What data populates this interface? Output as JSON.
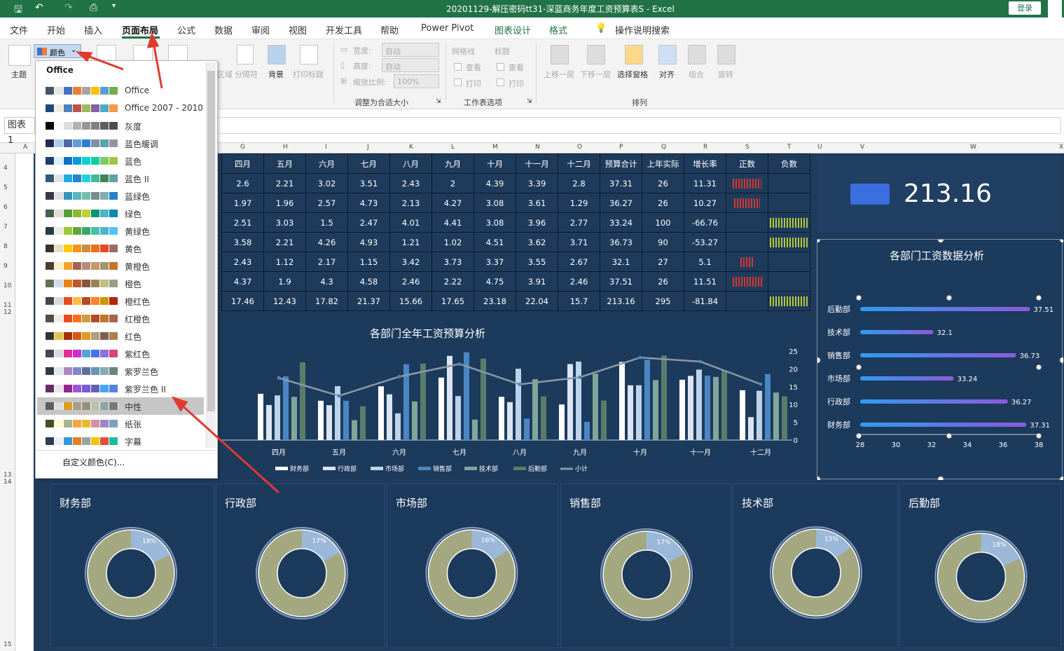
{
  "titlebar": {
    "title": "20201129-解压密码tt31-深蓝商务年度工资预算表S - Excel",
    "login": "登录"
  },
  "menu": {
    "tabs": [
      "文件",
      "开始",
      "插入",
      "页面布局",
      "公式",
      "数据",
      "审阅",
      "视图",
      "开发工具",
      "帮助",
      "Power Pivot",
      "图表设计",
      "格式"
    ],
    "search": "操作说明搜索"
  },
  "ribbon": {
    "themes": "主题",
    "colors": "颜色",
    "background": "背景",
    "print_titles": "打印标题",
    "breaks": "分隔符",
    "area": "区域",
    "width_label": "宽度:",
    "width_value": "自动",
    "height_label": "高度:",
    "height_value": "自动",
    "scale_label": "缩放比例:",
    "scale_value": "100%",
    "fit_group": "调整为合适大小",
    "gridlines": "网格线",
    "headings": "标题",
    "view1": "查看",
    "print1": "打印",
    "view2": "查看",
    "print2": "打印",
    "sheet_options": "工作表选项",
    "bring_forward": "上移一层",
    "send_backward": "下移一层",
    "selection_pane": "选择窗格",
    "align": "对齐",
    "group": "组合",
    "rotate": "旋转",
    "arrange": "排列"
  },
  "formula": {
    "namebox": "图表 1"
  },
  "columns": [
    "A",
    "G",
    "H",
    "I",
    "J",
    "K",
    "L",
    "M",
    "N",
    "O",
    "P",
    "Q",
    "R",
    "S",
    "T",
    "U",
    "V",
    "W",
    "X"
  ],
  "rows": [
    "4",
    "5",
    "6",
    "7",
    "8",
    "9",
    "10",
    "11",
    "12",
    "13",
    "14",
    "15"
  ],
  "dropdown": {
    "header": "Office",
    "items": [
      {
        "name": "Office",
        "colors": [
          "#44546a",
          "#e7e6e6",
          "#4472c4",
          "#ed7d31",
          "#a5a5a5",
          "#ffc000",
          "#5b9bd5",
          "#70ad47"
        ]
      },
      {
        "name": "Office 2007 - 2010",
        "colors": [
          "#1f497d",
          "#eeece1",
          "#4f81bd",
          "#c0504d",
          "#9bbb59",
          "#8064a2",
          "#4bacc6",
          "#f79646"
        ]
      },
      {
        "name": "灰度",
        "colors": [
          "#000000",
          "#f8f8f8",
          "#dddddd",
          "#b2b2b2",
          "#969696",
          "#808080",
          "#5f5f5f",
          "#4d4d4d"
        ]
      },
      {
        "name": "蓝色暖调",
        "colors": [
          "#242852",
          "#acccea",
          "#4a66ac",
          "#629dd1",
          "#297fd5",
          "#7f8fa9",
          "#5aa2ae",
          "#9d90a0"
        ]
      },
      {
        "name": "蓝色",
        "colors": [
          "#17406d",
          "#dbeff9",
          "#0f6fc6",
          "#009dd9",
          "#0bd0d9",
          "#10cf9b",
          "#7cca62",
          "#a5c249"
        ]
      },
      {
        "name": "蓝色 II",
        "colors": [
          "#335b74",
          "#dfe3e5",
          "#1cade4",
          "#2683c6",
          "#27ced7",
          "#42ba97",
          "#3e8853",
          "#62a39f"
        ]
      },
      {
        "name": "蓝绿色",
        "colors": [
          "#373545",
          "#dedede",
          "#3494ba",
          "#58b6c0",
          "#75bda7",
          "#7a8c8e",
          "#84acb6",
          "#2683c6"
        ]
      },
      {
        "name": "绿色",
        "colors": [
          "#455f51",
          "#e3ded1",
          "#549e39",
          "#8ab833",
          "#c0cf3a",
          "#029676",
          "#4ab5c4",
          "#0989b1"
        ]
      },
      {
        "name": "黄绿色",
        "colors": [
          "#2c3c43",
          "#ebebeb",
          "#99cb38",
          "#63a537",
          "#37a76f",
          "#44c1a3",
          "#4eb3cf",
          "#51c3f9"
        ]
      },
      {
        "name": "黄色",
        "colors": [
          "#39302a",
          "#e5dec5",
          "#ffca08",
          "#f8931d",
          "#ce8d3e",
          "#ec7016",
          "#e64823",
          "#9c6a6a"
        ]
      },
      {
        "name": "黄橙色",
        "colors": [
          "#4e3b30",
          "#fbeec9",
          "#f0a22e",
          "#a5644e",
          "#b58b80",
          "#c3986d",
          "#a19574",
          "#c17529"
        ]
      },
      {
        "name": "橙色",
        "colors": [
          "#637052",
          "#ccddea",
          "#e48312",
          "#bd582c",
          "#865640",
          "#9b8357",
          "#c2bc80",
          "#94a088"
        ]
      },
      {
        "name": "橙红色",
        "colors": [
          "#454545",
          "#dcd8dc",
          "#e84c22",
          "#ffbd47",
          "#b64926",
          "#ff8427",
          "#cc9900",
          "#b22600"
        ]
      },
      {
        "name": "红橙色",
        "colors": [
          "#505046",
          "#eeece1",
          "#e84c22",
          "#f27022",
          "#d19c3d",
          "#b64926",
          "#c17529",
          "#a5644e"
        ]
      },
      {
        "name": "红色",
        "colors": [
          "#323232",
          "#e5c243",
          "#a5300f",
          "#d55816",
          "#e19825",
          "#b19c7d",
          "#7f5f52",
          "#b27d49"
        ]
      },
      {
        "name": "紫红色",
        "colors": [
          "#454551",
          "#d8d9dc",
          "#e32d91",
          "#c830cc",
          "#4ea6dc",
          "#4775e7",
          "#8971e1",
          "#d54773"
        ]
      },
      {
        "name": "紫罗兰色",
        "colors": [
          "#373545",
          "#dceaf2",
          "#ad84c6",
          "#8784c7",
          "#5d739a",
          "#6997af",
          "#84acb6",
          "#6f8183"
        ]
      },
      {
        "name": "紫罗兰色 II",
        "colors": [
          "#632e62",
          "#eae5eb",
          "#92278f",
          "#9b57d3",
          "#755dd9",
          "#665eb8",
          "#45a5ed",
          "#5982db"
        ]
      },
      {
        "name": "中性",
        "colors": [
          "#5e5e5e",
          "#ddddde",
          "#dc9e1f",
          "#a69d8f",
          "#988f77",
          "#b6c4a8",
          "#8aa5aa",
          "#767b72"
        ]
      },
      {
        "name": "纸张",
        "colors": [
          "#444d26",
          "#fefac9",
          "#a5b592",
          "#f3a447",
          "#e7bc29",
          "#d092a7",
          "#9c85c0",
          "#809ec2"
        ]
      },
      {
        "name": "字幕",
        "colors": [
          "#2c3e50",
          "#ecf0f1",
          "#3498db",
          "#e67e22",
          "#95a5a6",
          "#f1c40f",
          "#e74c3c",
          "#1abc9c"
        ]
      }
    ],
    "custom": "自定义颜色(C)..."
  },
  "table": {
    "headers": [
      "四月",
      "五月",
      "六月",
      "七月",
      "八月",
      "九月",
      "十月",
      "十一月",
      "十二月",
      "预算合计",
      "上年实际",
      "增长率",
      "正数",
      "负数"
    ],
    "rows": [
      [
        "2.6",
        "2.21",
        "3.02",
        "3.51",
        "2.43",
        "2",
        "4.39",
        "3.39",
        "2.8",
        "37.31",
        "26",
        "11.31"
      ],
      [
        "1.97",
        "1.96",
        "2.57",
        "4.73",
        "2.13",
        "4.27",
        "3.08",
        "3.61",
        "1.29",
        "36.27",
        "26",
        "10.27"
      ],
      [
        "2.51",
        "3.03",
        "1.5",
        "2.47",
        "4.01",
        "4.41",
        "3.08",
        "3.96",
        "2.77",
        "33.24",
        "100",
        "-66.76"
      ],
      [
        "3.58",
        "2.21",
        "4.26",
        "4.93",
        "1.21",
        "1.02",
        "4.51",
        "3.62",
        "3.71",
        "36.73",
        "90",
        "-53.27"
      ],
      [
        "2.43",
        "1.12",
        "2.17",
        "1.15",
        "3.42",
        "3.73",
        "3.37",
        "3.55",
        "2.67",
        "32.1",
        "27",
        "5.1"
      ],
      [
        "4.37",
        "1.9",
        "4.3",
        "4.58",
        "2.46",
        "2.22",
        "4.75",
        "3.91",
        "2.46",
        "37.51",
        "26",
        "11.51"
      ],
      [
        "17.46",
        "12.43",
        "17.82",
        "21.37",
        "15.66",
        "17.65",
        "23.18",
        "22.04",
        "15.7",
        "213.16",
        "295",
        "-81.84"
      ]
    ]
  },
  "kpi": {
    "value": "213.16"
  },
  "chart_data": [
    {
      "type": "bar",
      "title": "各部门全年工资预算分析",
      "categories": [
        "四月",
        "五月",
        "六月",
        "七月",
        "八月",
        "九月",
        "十月",
        "十一月",
        "十二月"
      ],
      "series": [
        {
          "name": "财务部",
          "values": [
            2.6,
            2.21,
            3.02,
            3.51,
            2.43,
            2,
            4.39,
            3.39,
            2.8
          ]
        },
        {
          "name": "行政部",
          "values": [
            1.97,
            1.96,
            2.57,
            4.73,
            2.13,
            4.27,
            3.08,
            3.61,
            1.29
          ]
        },
        {
          "name": "市场部",
          "values": [
            2.51,
            3.03,
            1.5,
            2.47,
            4.01,
            4.41,
            3.08,
            3.96,
            2.77
          ]
        },
        {
          "name": "销售部",
          "values": [
            3.58,
            2.21,
            4.26,
            4.93,
            1.21,
            1.02,
            4.51,
            3.62,
            3.71
          ]
        },
        {
          "name": "技术部",
          "values": [
            2.43,
            1.12,
            2.17,
            1.15,
            3.42,
            3.73,
            3.37,
            3.55,
            2.67
          ]
        },
        {
          "name": "后勤部",
          "values": [
            4.37,
            1.9,
            4.3,
            4.58,
            2.46,
            2.22,
            4.75,
            3.91,
            2.46
          ]
        },
        {
          "name": "小计",
          "values": [
            17.46,
            12.43,
            17.82,
            21.37,
            15.66,
            17.65,
            23.18,
            22.04,
            15.7
          ]
        }
      ],
      "ylim": [
        0,
        25
      ],
      "yticks": [
        "0",
        "5",
        "10",
        "15",
        "20",
        "25"
      ],
      "colors": [
        "#ffffff",
        "#dbe4f0",
        "#bdd3ea",
        "#4b86c2",
        "#7fa79a",
        "#5a7d6a",
        "#8c9aa5"
      ]
    },
    {
      "type": "bar",
      "title": "各部门工资数据分析",
      "categories": [
        "后勤部",
        "技术部",
        "销售部",
        "市场部",
        "行政部",
        "财务部"
      ],
      "values": [
        37.51,
        32.1,
        36.73,
        33.24,
        36.27,
        37.31
      ],
      "labels": [
        "37.51",
        "32.1",
        "36.73",
        "33.24",
        "36.27",
        "37.31"
      ],
      "xlim": [
        28,
        38
      ],
      "xticks": [
        "28",
        "30",
        "32",
        "34",
        "36",
        "38"
      ]
    },
    {
      "type": "pie",
      "donuts": [
        {
          "name": "财务部",
          "pct": 0.18,
          "label": "18%"
        },
        {
          "name": "行政部",
          "pct": 0.17,
          "label": "17%"
        },
        {
          "name": "市场部",
          "pct": 0.16,
          "label": "16%"
        },
        {
          "name": "销售部",
          "pct": 0.17,
          "label": "17%"
        },
        {
          "name": "技术部",
          "pct": 0.15,
          "label": "15%"
        },
        {
          "name": "后勤部",
          "pct": 0.18,
          "label": "18%"
        }
      ],
      "colors": [
        "#9cb8d8",
        "#a4a880"
      ]
    }
  ]
}
